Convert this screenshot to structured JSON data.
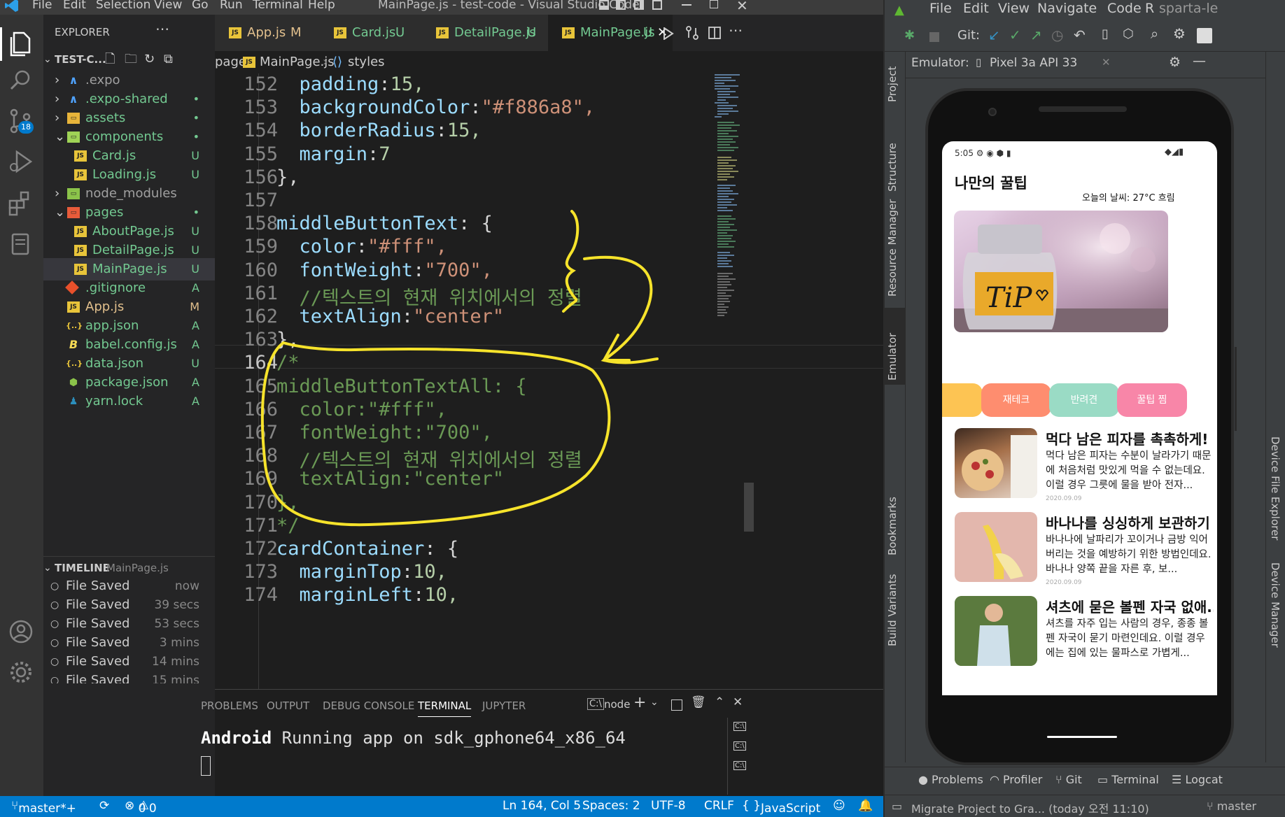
{
  "vscode": {
    "menu": [
      "File",
      "Edit",
      "Selection",
      "View",
      "Go",
      "Run",
      "Terminal",
      "Help"
    ],
    "window_title": "MainPage.js - test-code - Visual Studio Code",
    "activity": {
      "source_control_badge": "18"
    },
    "explorer": {
      "title": "EXPLORER",
      "project": "TEST-C...",
      "items": [
        {
          "name": ".expo",
          "status": ""
        },
        {
          "name": ".expo-shared",
          "status": "•"
        },
        {
          "name": "assets",
          "status": "•"
        },
        {
          "name": "components",
          "status": "•"
        },
        {
          "name": "Card.js",
          "status": "U"
        },
        {
          "name": "Loading.js",
          "status": "U"
        },
        {
          "name": "node_modules",
          "status": "•"
        },
        {
          "name": "pages",
          "status": "•"
        },
        {
          "name": "AboutPage.js",
          "status": "U"
        },
        {
          "name": "DetailPage.js",
          "status": "U"
        },
        {
          "name": "MainPage.js",
          "status": "U"
        },
        {
          "name": ".gitignore",
          "status": "A"
        },
        {
          "name": "App.js",
          "status": "M"
        },
        {
          "name": "app.json",
          "status": "A"
        },
        {
          "name": "babel.config.js",
          "status": "A"
        },
        {
          "name": "data.json",
          "status": "U"
        },
        {
          "name": "package.json",
          "status": "A"
        },
        {
          "name": "yarn.lock",
          "status": "A"
        }
      ],
      "timeline_title": "TIMELINE",
      "timeline_file": "MainPage.js",
      "timeline": [
        {
          "label": "File Saved",
          "time": "now"
        },
        {
          "label": "File Saved",
          "time": "39 secs"
        },
        {
          "label": "File Saved",
          "time": "53 secs"
        },
        {
          "label": "File Saved",
          "time": "3 mins"
        },
        {
          "label": "File Saved",
          "time": "14 mins"
        },
        {
          "label": "File Saved",
          "time": "15 mins"
        }
      ]
    },
    "tabs": [
      {
        "name": "App.js",
        "status": "M"
      },
      {
        "name": "Card.js",
        "status": "U"
      },
      {
        "name": "DetailPage.js",
        "status": "U"
      },
      {
        "name": "MainPage.js",
        "status": "U"
      }
    ],
    "breadcrumb": [
      "pages",
      "MainPage.js",
      "styles"
    ],
    "code": [
      {
        "n": "152",
        "t": "  padding:15,"
      },
      {
        "n": "153",
        "t": "  backgroundColor:\"#f886a8\","
      },
      {
        "n": "154",
        "t": "  borderRadius:15,"
      },
      {
        "n": "155",
        "t": "  margin:7"
      },
      {
        "n": "156",
        "t": "},"
      },
      {
        "n": "157",
        "t": ""
      },
      {
        "n": "158",
        "t": "middleButtonText: {"
      },
      {
        "n": "159",
        "t": "  color:\"#fff\","
      },
      {
        "n": "160",
        "t": "  fontWeight:\"700\","
      },
      {
        "n": "161",
        "t": "  //텍스트의 현재 위치에서의 정렬"
      },
      {
        "n": "162",
        "t": "  textAlign:\"center\""
      },
      {
        "n": "163",
        "t": "},"
      },
      {
        "n": "164",
        "t": "/*"
      },
      {
        "n": "165",
        "t": "middleButtonTextAll: {"
      },
      {
        "n": "166",
        "t": "  color:\"#fff\","
      },
      {
        "n": "167",
        "t": "  fontWeight:\"700\","
      },
      {
        "n": "168",
        "t": "  //텍스트의 현재 위치에서의 정렬"
      },
      {
        "n": "169",
        "t": "  textAlign:\"center\""
      },
      {
        "n": "170",
        "t": "},"
      },
      {
        "n": "171",
        "t": "*/"
      },
      {
        "n": "172",
        "t": "cardContainer: {"
      },
      {
        "n": "173",
        "t": "  marginTop:10,"
      },
      {
        "n": "174",
        "t": "  marginLeft:10,"
      }
    ],
    "panel": {
      "tabs": [
        "PROBLEMS",
        "OUTPUT",
        "DEBUG CONSOLE",
        "TERMINAL",
        "JUPYTER"
      ],
      "active": "TERMINAL",
      "shell": "node",
      "terminal_bold": "Android",
      "terminal_text": " Running app on sdk_gphone64_x86_64"
    },
    "status": {
      "branch": "master*+",
      "errors": "0",
      "warnings": "0",
      "position": "Ln 164, Col 5",
      "spaces": "Spaces: 2",
      "encoding": "UTF-8",
      "eol": "CRLF",
      "language": "JavaScript"
    }
  },
  "android_studio": {
    "menu": [
      "File",
      "Edit",
      "View",
      "Navigate",
      "Code",
      "R",
      "sparta-le"
    ],
    "git_label": "Git:",
    "emulator_label": "Emulator:",
    "device": "Pixel 3a API 33",
    "side_tabs": [
      "Project",
      "Structure",
      "Resource Manager",
      "Emulator",
      "Bookmarks",
      "Build Variants"
    ],
    "right_tabs": [
      "Device File Explorer",
      "Device Manager"
    ],
    "bottom_tabs": [
      "Problems",
      "Profiler",
      "Git",
      "Terminal",
      "Logcat"
    ],
    "status_text": "Migrate Project to Gra... (today 오전 11:10)",
    "branch": "master"
  },
  "app": {
    "time": "5:05",
    "title": "나만의 꿀팁",
    "weather": "오늘의 날씨: 27°C 흐림",
    "hero_text": "TiP",
    "categories": [
      {
        "label": "",
        "color": "#fdc453"
      },
      {
        "label": "재테크",
        "color": "#fe8d6f"
      },
      {
        "label": "반려견",
        "color": "#9adbc5"
      },
      {
        "label": "꿀팁 찜",
        "color": "#f886a8"
      }
    ],
    "cards": [
      {
        "title": "먹다 남은 피자를 촉촉하게!",
        "desc": "먹다 남은 피자는 수분이 날라가기 때문에 처음처럼 맛있게 먹을 수 없는데요. 이럴 경우 그릇에 물을 받아 전자...",
        "date": "2020.09.09"
      },
      {
        "title": "바나나를 싱싱하게 보관하기",
        "desc": "바나나에 날파리가 꼬이거나 금방 익어버리는 것을 예방하기 위한 방법인데요. 바나나 양쪽 끝을 자른 후, 보...",
        "date": "2020.09.09"
      },
      {
        "title": "셔츠에 묻은 볼펜 자국 없애..",
        "desc": "셔츠를 자주 입는 사람의 경우, 종종 볼펜 자국이 묻기 마련인데요. 이럴 경우에는 집에 있는 물파스로 가볍게...",
        "date": ""
      }
    ]
  }
}
